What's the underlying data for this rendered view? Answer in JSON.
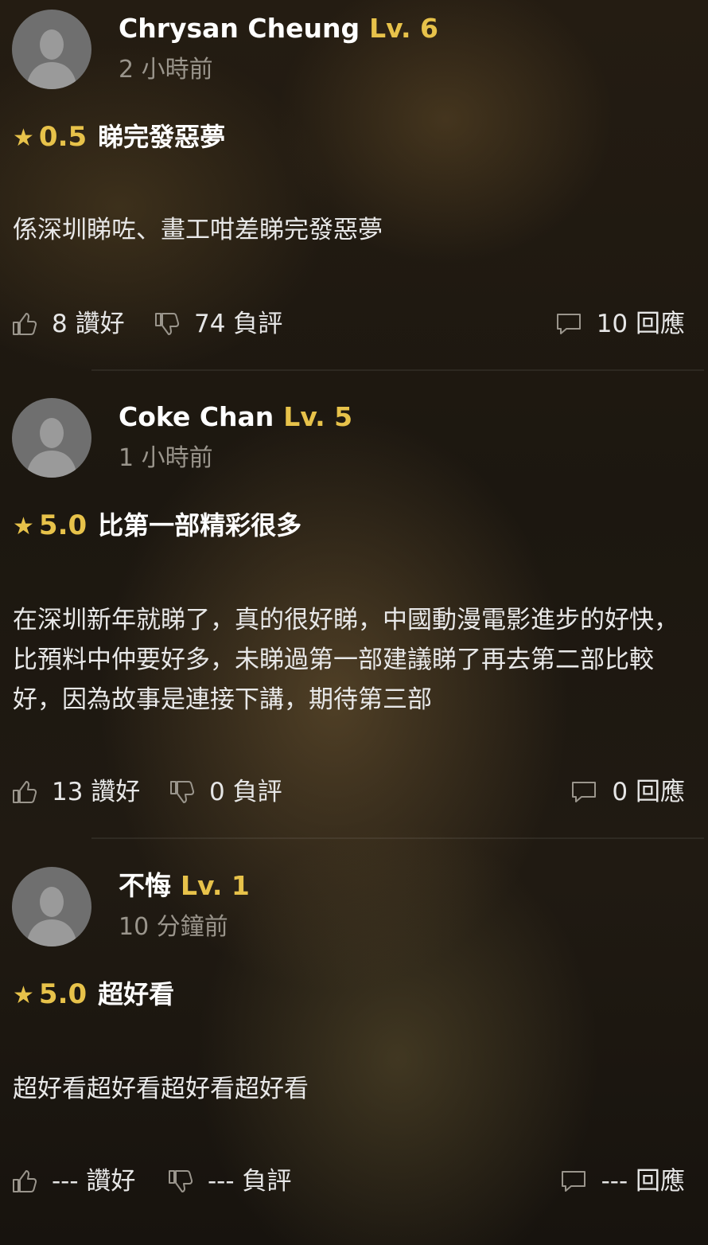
{
  "reviews": [
    {
      "user": "Chrysan Cheung",
      "level": "Lv. 6",
      "time": "2 小時前",
      "score": "0.5",
      "headline": "睇完發惡夢",
      "body": "係深圳睇咗、畫工咁差睇完發惡夢",
      "likes": "8 讚好",
      "dislikes": "74 負評",
      "replies": "10 回應"
    },
    {
      "user": "Coke Chan",
      "level": "Lv. 5",
      "time": "1 小時前",
      "score": "5.0",
      "headline": "比第一部精彩很多",
      "body": "在深圳新年就睇了，真的很好睇，中國動漫電影進步的好快，比預料中仲要好多，未睇過第一部建議睇了再去第二部比較好，因為故事是連接下講，期待第三部",
      "likes": "13 讚好",
      "dislikes": "0 負評",
      "replies": "0 回應"
    },
    {
      "user": "不悔",
      "level": "Lv. 1",
      "time": "10 分鐘前",
      "score": "5.0",
      "headline": "超好看",
      "body": "超好看超好看超好看超好看",
      "likes": "--- 讚好",
      "dislikes": "--- 負評",
      "replies": "--- 回應"
    }
  ],
  "colors": {
    "accent": "#e7c24a",
    "muted": "#9a958c",
    "text": "#e8e8e8"
  },
  "icons": {
    "star": "★",
    "like": "thumbs-up-icon",
    "dislike": "thumbs-down-icon",
    "reply": "speech-bubble-icon",
    "avatar": "default-avatar-icon"
  }
}
